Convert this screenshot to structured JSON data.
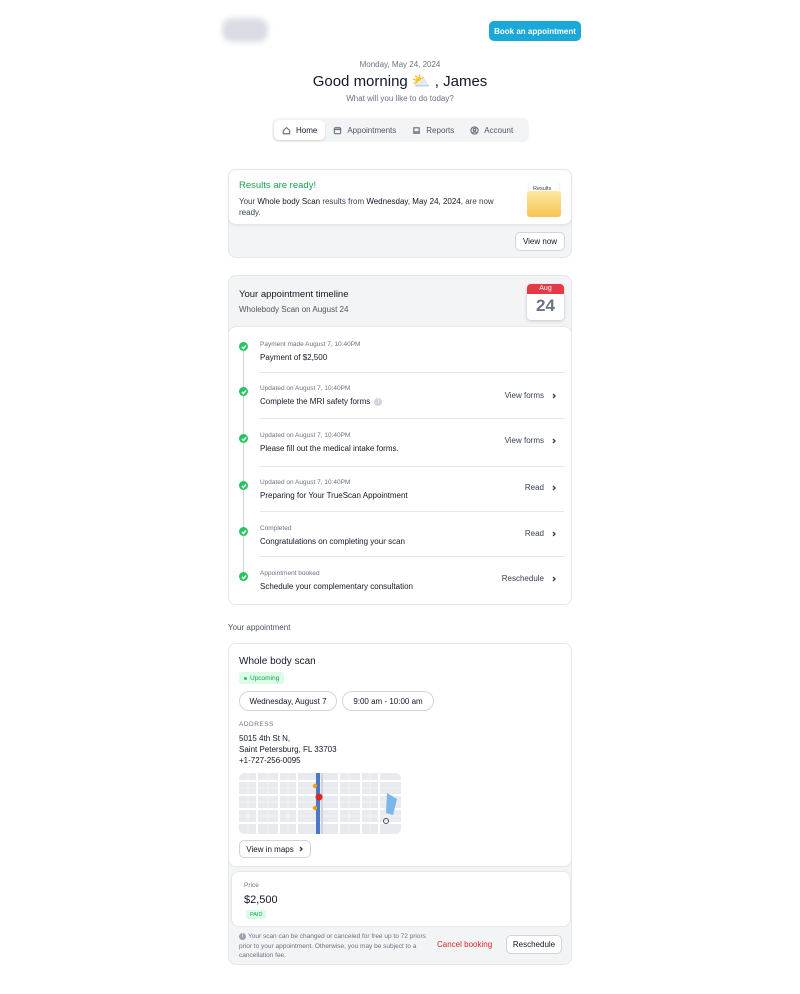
{
  "header": {
    "book_label": "Book an appointment"
  },
  "greeting": {
    "date": "Monday, May 24, 2024",
    "text": "Good morning ⛅ , James",
    "question": "What will you like to do today?"
  },
  "nav": {
    "items": [
      {
        "label": "Home",
        "icon": "home-icon",
        "active": true
      },
      {
        "label": "Appointments",
        "icon": "calendar-icon"
      },
      {
        "label": "Reports",
        "icon": "laptop-icon"
      },
      {
        "label": "Account",
        "icon": "user-icon"
      }
    ]
  },
  "results": {
    "title": "Results are ready!",
    "text_prefix": "Your ",
    "scan_name": "Whole body Scan",
    "text_mid": " results from ",
    "date": "Wednesday, May 24, 2024",
    "text_suffix": ", are now ready.",
    "folder_label": "Results",
    "button": "View now"
  },
  "timeline": {
    "title": "Your appointment timeline",
    "subtitle": "Wholebody Scan on August 24",
    "calendar_month": "Aug",
    "calendar_day": "24",
    "items": [
      {
        "meta": "Payment made August 7, 10:40PM",
        "text": "Payment of $2,500",
        "action": ""
      },
      {
        "meta": "Updated on August 7, 10:40PM",
        "text": "Complete the MRI safety forms",
        "action": "View forms"
      },
      {
        "meta": "Updated on August 7, 10:40PM",
        "text": "Please fill out the medical intake forms.",
        "action": "View forms"
      },
      {
        "meta": "Updated on August 7, 10:40PM",
        "text": "Preparing for Your TrueScan Appointment",
        "action": "Read"
      },
      {
        "meta": "Completed",
        "text": "Congratulations on completing your scan",
        "action": "Read"
      },
      {
        "meta": "Appointment booked",
        "text": "Schedule your complementary consultation",
        "action": "Reschedule"
      }
    ]
  },
  "appointment": {
    "section_label": "Your appointment",
    "title": "Whole body scan",
    "status": "Upcoming",
    "date": "Wednesday, August 7",
    "time": "9:00 am - 10:00 am",
    "address_label": "ADDRESS",
    "address_lines": [
      "5015 4th St N,",
      "Saint Petersburg, FL 33703",
      "+1-727-256-0095"
    ],
    "map_button": "View in maps",
    "price_label": "Price",
    "price": "$2,500",
    "paid": "PAID",
    "note": "Your scan can be changed or canceled for free up to 72 priors prior to your appointment. Otherwise, you may be subject to a cancellation fee.",
    "cancel_label": "Cancel booking",
    "reschedule_label": "Reschedule"
  },
  "colors": {
    "accent": "#19a8d8",
    "success": "#22c55e",
    "danger": "#dc2626",
    "calendar_red": "#e63946"
  }
}
